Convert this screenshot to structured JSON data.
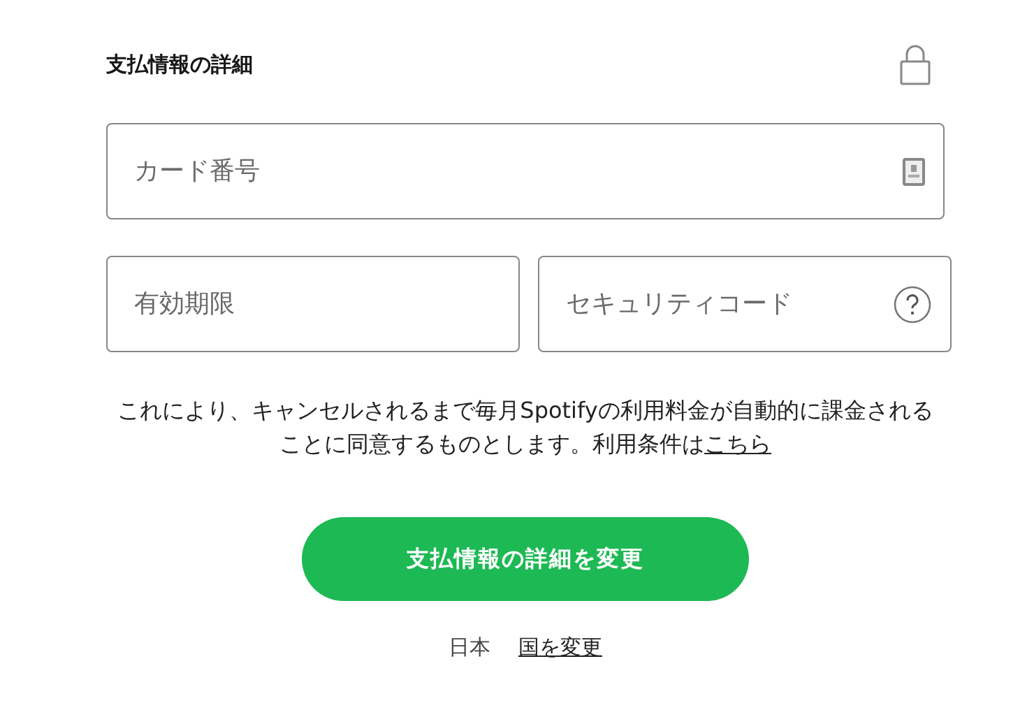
{
  "section": {
    "title": "支払情報の詳細"
  },
  "fields": [
    {
      "placeholder": "カード番号",
      "kind": "card"
    },
    {
      "placeholder": "有効期限",
      "kind": "plain"
    },
    {
      "placeholder": "セキュリティコード",
      "kind": "help"
    }
  ],
  "notice": {
    "text": "これにより、キャンセルされるまで毎月Spotifyの利用料金が自動的に課金されることに同意するものとします。利用条件は",
    "link": "こちら"
  },
  "submit_button": "支払情報の詳細を変更",
  "footer": {
    "country": "日本",
    "change_link": "国を変更"
  }
}
